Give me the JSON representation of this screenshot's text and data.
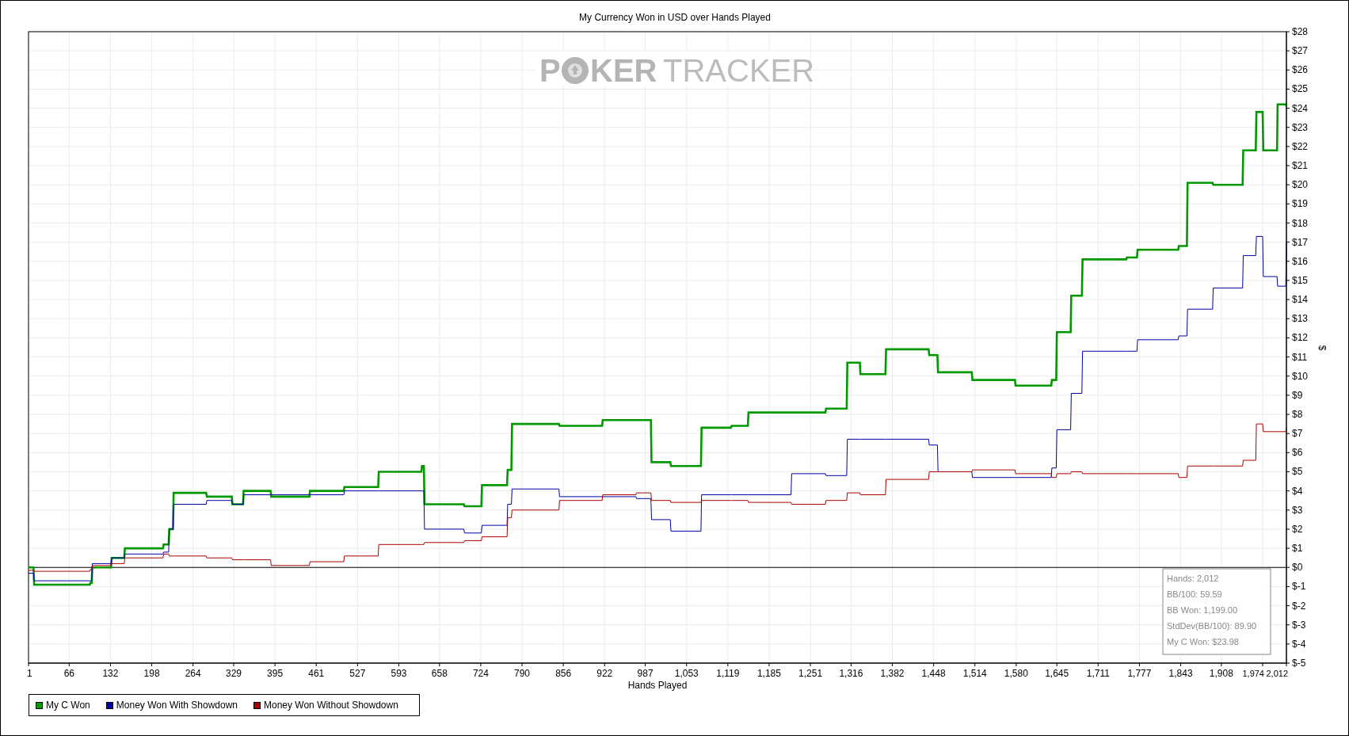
{
  "logo": {
    "left": "P",
    "middle": "KER",
    "right": "TRACKER"
  },
  "chart_data": {
    "type": "line",
    "title": "My Currency Won in USD over Hands Played",
    "xlabel": "Hands Played",
    "ylabel": "$",
    "x": [
      1,
      9,
      10,
      99,
      100,
      102,
      103,
      133,
      134,
      154,
      155,
      216,
      217,
      225,
      226,
      232,
      233,
      285,
      286,
      326,
      327,
      344,
      345,
      388,
      389,
      450,
      451,
      505,
      506,
      560,
      561,
      629,
      630,
      633,
      634,
      697,
      698,
      725,
      726,
      766,
      767,
      773,
      774,
      849,
      850,
      918,
      919,
      972,
      973,
      996,
      997,
      1027,
      1028,
      1076,
      1077,
      1124,
      1125,
      1151,
      1152,
      1220,
      1221,
      1275,
      1276,
      1309,
      1310,
      1330,
      1331,
      1371,
      1372,
      1440,
      1441,
      1454,
      1455,
      1509,
      1510,
      1578,
      1579,
      1636,
      1637,
      1644,
      1645,
      1667,
      1668,
      1685,
      1686,
      1756,
      1757,
      1773,
      1774,
      1839,
      1840,
      1853,
      1854,
      1894,
      1895,
      1942,
      1943,
      1963,
      1964,
      1974,
      1975,
      1997,
      1998,
      2011,
      2012
    ],
    "grid": true,
    "series": [
      {
        "name": "My C Won",
        "color": "#009900",
        "values": [
          0,
          0,
          -0.9,
          -0.9,
          -0.8,
          -0.8,
          0,
          0,
          0.5,
          0.5,
          1,
          1,
          1.2,
          1.2,
          2,
          2,
          3.9,
          3.9,
          3.7,
          3.7,
          3.3,
          3.3,
          4,
          4,
          3.7,
          3.7,
          4,
          4,
          4.2,
          4.2,
          5,
          5,
          5.3,
          5.3,
          3.3,
          3.3,
          3.2,
          3.2,
          4.3,
          4.3,
          5.1,
          5.1,
          7.5,
          7.5,
          7.4,
          7.4,
          7.7,
          7.7,
          7.7,
          7.7,
          5.5,
          5.5,
          5.3,
          5.3,
          7.3,
          7.3,
          7.4,
          7.4,
          8.1,
          8.1,
          8.1,
          8.1,
          8.3,
          8.3,
          10.7,
          10.7,
          10.1,
          10.1,
          11.4,
          11.4,
          11.1,
          11.1,
          10.2,
          10.2,
          9.8,
          9.8,
          9.5,
          9.5,
          9.8,
          9.8,
          12.3,
          12.3,
          14.2,
          14.2,
          16.1,
          16.1,
          16.2,
          16.2,
          16.6,
          16.6,
          16.8,
          16.8,
          20.1,
          20.1,
          20,
          20,
          21.8,
          21.8,
          23.8,
          23.8,
          21.8,
          21.8,
          24.2,
          24.2,
          24.1
        ]
      },
      {
        "name": "Money Won With Showdown",
        "color": "#0000aa",
        "values": [
          -0.3,
          -0.3,
          -0.7,
          -0.7,
          -0.7,
          -0.7,
          0.2,
          0.2,
          0.5,
          0.5,
          0.7,
          0.7,
          0.8,
          0.8,
          2,
          2,
          3.3,
          3.3,
          3.5,
          3.5,
          3.3,
          3.3,
          3.8,
          3.8,
          3.8,
          3.8,
          3.8,
          3.8,
          4,
          4,
          4,
          4,
          4,
          4,
          2,
          2,
          1.8,
          1.8,
          2.2,
          2.2,
          3.3,
          3.3,
          4.1,
          4.1,
          3.7,
          3.7,
          3.7,
          3.7,
          3.6,
          3.6,
          2.5,
          2.5,
          1.9,
          1.9,
          3.8,
          3.8,
          3.8,
          3.8,
          3.8,
          3.8,
          4.9,
          4.9,
          4.8,
          4.8,
          6.7,
          6.7,
          6.7,
          6.7,
          6.7,
          6.7,
          6.4,
          6.4,
          5,
          5,
          4.7,
          4.7,
          4.7,
          4.7,
          5.2,
          5.2,
          7.2,
          7.2,
          9.1,
          9.1,
          11.3,
          11.3,
          11.3,
          11.3,
          11.9,
          11.9,
          12.1,
          12.1,
          13.5,
          13.5,
          14.6,
          14.6,
          16.3,
          16.3,
          17.3,
          17.3,
          15.2,
          15.2,
          14.7,
          14.7,
          17
        ]
      },
      {
        "name": "Money Won Without Showdown",
        "color": "#aa0000",
        "values": [
          -0.15,
          -0.15,
          -0.2,
          -0.2,
          -0.1,
          -0.1,
          0.1,
          0.1,
          0.2,
          0.2,
          0.5,
          0.5,
          0.7,
          0.7,
          0.6,
          0.6,
          0.6,
          0.6,
          0.5,
          0.5,
          0.4,
          0.4,
          0.4,
          0.4,
          0.1,
          0.1,
          0.3,
          0.3,
          0.6,
          0.6,
          1.2,
          1.2,
          1.2,
          1.2,
          1.3,
          1.3,
          1.4,
          1.4,
          1.6,
          1.6,
          2.6,
          2.6,
          3,
          3,
          3.5,
          3.5,
          3.8,
          3.8,
          3.9,
          3.9,
          3.5,
          3.5,
          3.4,
          3.4,
          3.5,
          3.5,
          3.5,
          3.5,
          3.4,
          3.4,
          3.3,
          3.3,
          3.5,
          3.5,
          3.9,
          3.9,
          3.8,
          3.8,
          4.6,
          4.6,
          5,
          5,
          5,
          5,
          5.1,
          5.1,
          4.9,
          4.9,
          4.7,
          4.7,
          4.9,
          4.9,
          5,
          5,
          4.9,
          4.9,
          4.9,
          4.9,
          4.9,
          4.9,
          4.7,
          4.7,
          5.3,
          5.3,
          5.3,
          5.3,
          5.6,
          5.6,
          7.5,
          7.5,
          7.1,
          7.1,
          7.1,
          7.1,
          7.3
        ]
      }
    ],
    "xlim": [
      1,
      2012
    ],
    "ylim": [
      -5,
      28
    ],
    "xticks": [
      1,
      66,
      132,
      198,
      264,
      329,
      395,
      461,
      527,
      593,
      658,
      724,
      790,
      856,
      922,
      987,
      {
        "value": 1053,
        "label": "1,053"
      },
      {
        "value": 1119,
        "label": "1,119"
      },
      {
        "value": 1185,
        "label": "1,185"
      },
      {
        "value": 1251,
        "label": "1,251"
      },
      {
        "value": 1316,
        "label": "1,316"
      },
      {
        "value": 1382,
        "label": "1,382"
      },
      {
        "value": 1448,
        "label": "1,448"
      },
      {
        "value": 1514,
        "label": "1,514"
      },
      {
        "value": 1580,
        "label": "1,580"
      },
      {
        "value": 1645,
        "label": "1,645"
      },
      {
        "value": 1711,
        "label": "1,711"
      },
      {
        "value": 1777,
        "label": "1,777"
      },
      {
        "value": 1843,
        "label": "1,843"
      },
      {
        "value": 1908,
        "label": "1,908"
      },
      {
        "value": 1974,
        "label": "1,974"
      },
      {
        "value": 2012,
        "label": "2,012"
      }
    ],
    "yticks": [
      {
        "value": -5,
        "label": "$-5"
      },
      {
        "value": -4,
        "label": "$-4"
      },
      {
        "value": -3,
        "label": "$-3"
      },
      {
        "value": -2,
        "label": "$-2"
      },
      {
        "value": -1,
        "label": "$-1"
      },
      {
        "value": 0,
        "label": "$0"
      },
      {
        "value": 1,
        "label": "$1"
      },
      {
        "value": 2,
        "label": "$2"
      },
      {
        "value": 3,
        "label": "$3"
      },
      {
        "value": 4,
        "label": "$4"
      },
      {
        "value": 5,
        "label": "$5"
      },
      {
        "value": 6,
        "label": "$6"
      },
      {
        "value": 7,
        "label": "$7"
      },
      {
        "value": 8,
        "label": "$8"
      },
      {
        "value": 9,
        "label": "$9"
      },
      {
        "value": 10,
        "label": "$10"
      },
      {
        "value": 11,
        "label": "$11"
      },
      {
        "value": 12,
        "label": "$12"
      },
      {
        "value": 13,
        "label": "$13"
      },
      {
        "value": 14,
        "label": "$14"
      },
      {
        "value": 15,
        "label": "$15"
      },
      {
        "value": 16,
        "label": "$16"
      },
      {
        "value": 17,
        "label": "$17"
      },
      {
        "value": 18,
        "label": "$18"
      },
      {
        "value": 19,
        "label": "$19"
      },
      {
        "value": 20,
        "label": "$20"
      },
      {
        "value": 21,
        "label": "$21"
      },
      {
        "value": 22,
        "label": "$22"
      },
      {
        "value": 23,
        "label": "$23"
      },
      {
        "value": 24,
        "label": "$24"
      },
      {
        "value": 25,
        "label": "$25"
      },
      {
        "value": 26,
        "label": "$26"
      },
      {
        "value": 27,
        "label": "$27"
      },
      {
        "value": 28,
        "label": "$28"
      }
    ]
  },
  "stats": [
    "Hands: 2,012",
    "BB/100: 59.59",
    "BB Won: 1,199.00",
    "StdDev(BB/100): 89.90",
    "My C Won: $23.98"
  ]
}
